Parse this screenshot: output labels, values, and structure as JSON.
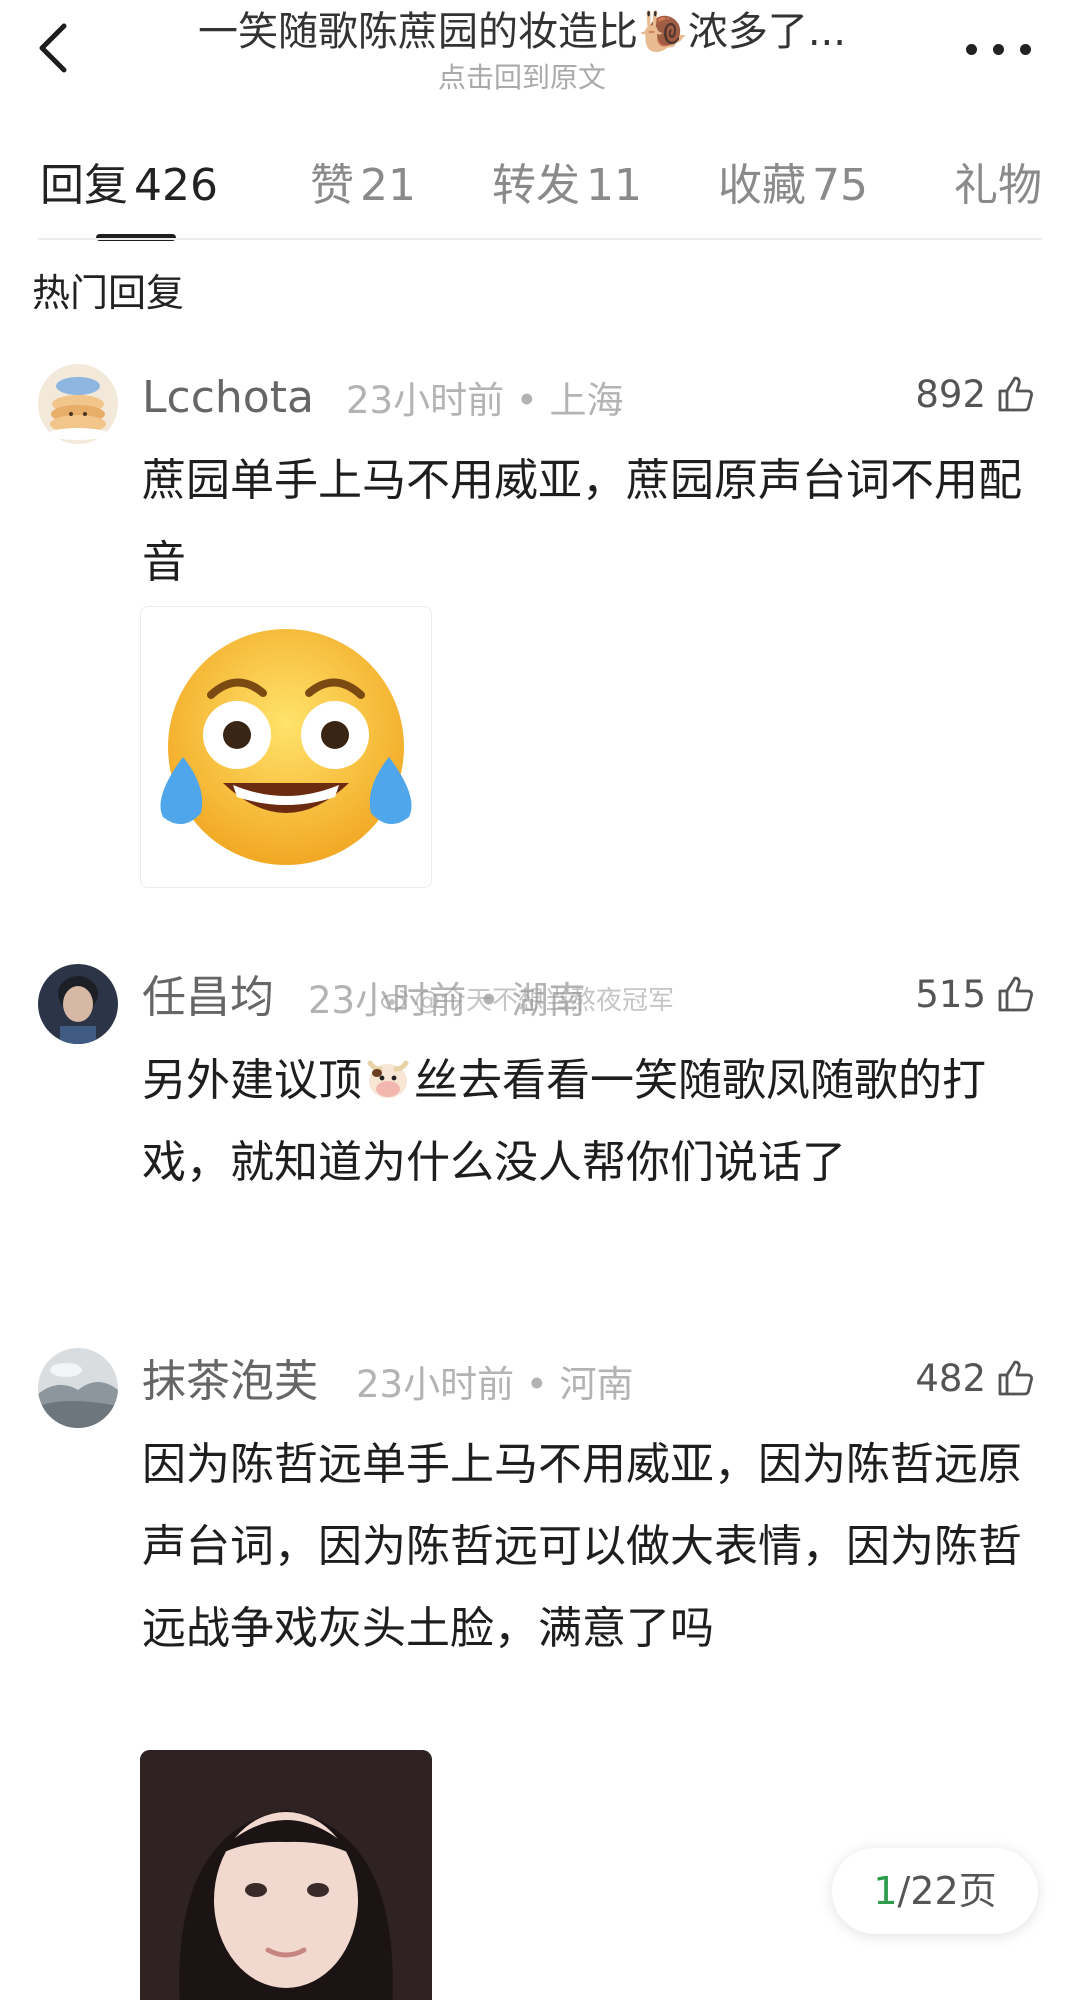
{
  "header": {
    "title": "一笑随歌陈蔗园的妆造比🐌浓多了...",
    "subtitle": "点击回到原文"
  },
  "tabs": [
    {
      "label": "回复",
      "count": "426"
    },
    {
      "label": "赞",
      "count": "21"
    },
    {
      "label": "转发",
      "count": "11"
    },
    {
      "label": "收藏",
      "count": "75"
    },
    {
      "label": "礼物",
      "count": ""
    }
  ],
  "section_title": "热门回复",
  "comments": [
    {
      "username": "Lcchota",
      "time": "23小时前",
      "location": "上海",
      "likes": "892",
      "text": "蔗园单手上马不用威亚，蔗园原声台词不用配音",
      "avatar": "pancake-avatar",
      "media": "crying-laughing-sticker"
    },
    {
      "username": "任昌均",
      "time": "23小时前",
      "location": "湖南",
      "likes": "515",
      "text_before": "另外建议顶",
      "text_after": "丝去看看一笑随歌凤随歌的打戏，就知道为什么没人帮你们说话了",
      "inline_icon": "cow-emoji",
      "avatar": "portrait-avatar"
    },
    {
      "username": "抹茶泡芙",
      "time": "23小时前",
      "location": "河南",
      "likes": "482",
      "text": "因为陈哲远单手上马不用威亚，因为陈哲远原声台词，因为陈哲远可以做大表情，因为陈哲远战争戏灰头土脸，满意了吗",
      "avatar": "cloud-landscape-avatar",
      "media": "girl-photo"
    }
  ],
  "watermark": "@今天不想当熬夜冠军",
  "pager": {
    "current": "1",
    "total": "/22页"
  },
  "colors": {
    "pager_current": "#2f9c4b",
    "meta_text": "#b3b3b3",
    "tab_inactive": "#8a8a8a"
  }
}
